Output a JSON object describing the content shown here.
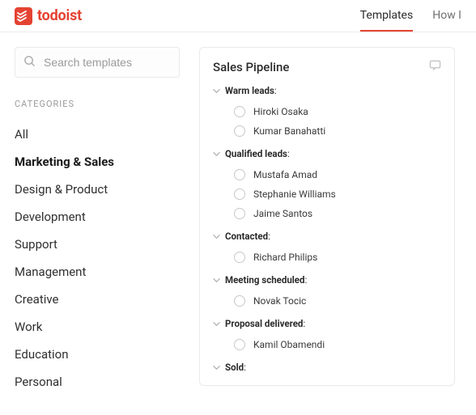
{
  "brand": "todoist",
  "nav": {
    "templates": "Templates",
    "how": "How I"
  },
  "search": {
    "placeholder": "Search templates"
  },
  "categoriesHeading": "CATEGORIES",
  "categories": [
    "All",
    "Marketing & Sales",
    "Design & Product",
    "Development",
    "Support",
    "Management",
    "Creative",
    "Work",
    "Education",
    "Personal"
  ],
  "activeCategoryIndex": 1,
  "card": {
    "title": "Sales Pipeline",
    "sections": [
      {
        "name": "Warm leads",
        "tasks": [
          "Hiroki Osaka",
          "Kumar Banahatti"
        ]
      },
      {
        "name": "Qualified leads",
        "tasks": [
          "Mustafa Amad",
          "Stephanie Williams",
          "Jaime Santos"
        ]
      },
      {
        "name": "Contacted",
        "tasks": [
          "Richard Philips"
        ]
      },
      {
        "name": "Meeting scheduled",
        "tasks": [
          "Novak Tocic"
        ]
      },
      {
        "name": "Proposal delivered",
        "tasks": [
          "Kamil Obamendi"
        ]
      },
      {
        "name": "Sold",
        "tasks": []
      }
    ]
  }
}
